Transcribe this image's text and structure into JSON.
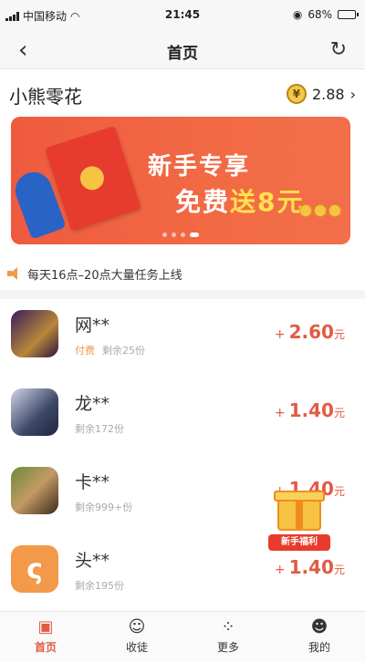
{
  "status_bar": {
    "carrier": "中国移动",
    "time": "21:45",
    "battery": "68%",
    "battery_level": 0.68
  },
  "nav": {
    "title": "首页",
    "back_icon": "chevron-left-icon",
    "refresh_icon": "refresh-icon"
  },
  "user": {
    "name": "小熊零花",
    "currency_symbol": "¥",
    "balance": "2.88",
    "balance_chevron": "›"
  },
  "banner": {
    "line1": "新手专享",
    "line2_prefix": "免费",
    "line2_highlight": "送8元",
    "slides_total": 4,
    "active_slide": 3
  },
  "notice": {
    "text": "每天16点–20点大量任务上线"
  },
  "tasks": [
    {
      "title": "网**",
      "tag": "付费",
      "remaining": "剩余25份",
      "plus": "+",
      "amount": "2.60",
      "unit": "元"
    },
    {
      "title": "龙**",
      "tag": "",
      "remaining": "剩余172份",
      "plus": "+",
      "amount": "1.40",
      "unit": "元"
    },
    {
      "title": "卡**",
      "tag": "",
      "remaining": "剩余999+份",
      "plus": "+",
      "amount": "1.40",
      "unit": "元"
    },
    {
      "title": "头**",
      "tag": "",
      "remaining": "剩余195份",
      "plus": "+",
      "amount": "1.40",
      "unit": "元"
    }
  ],
  "gift_badge": {
    "label": "新手福利"
  },
  "tab_bar": [
    {
      "label": "首页",
      "icon": "home-icon",
      "active": true
    },
    {
      "label": "收徒",
      "icon": "disciple-icon",
      "active": false
    },
    {
      "label": "更多",
      "icon": "more-icon",
      "active": false
    },
    {
      "label": "我的",
      "icon": "profile-icon",
      "active": false
    }
  ],
  "colors": {
    "accent": "#e25a44",
    "banner": "#ef5a3f",
    "tag": "#f2994a"
  }
}
